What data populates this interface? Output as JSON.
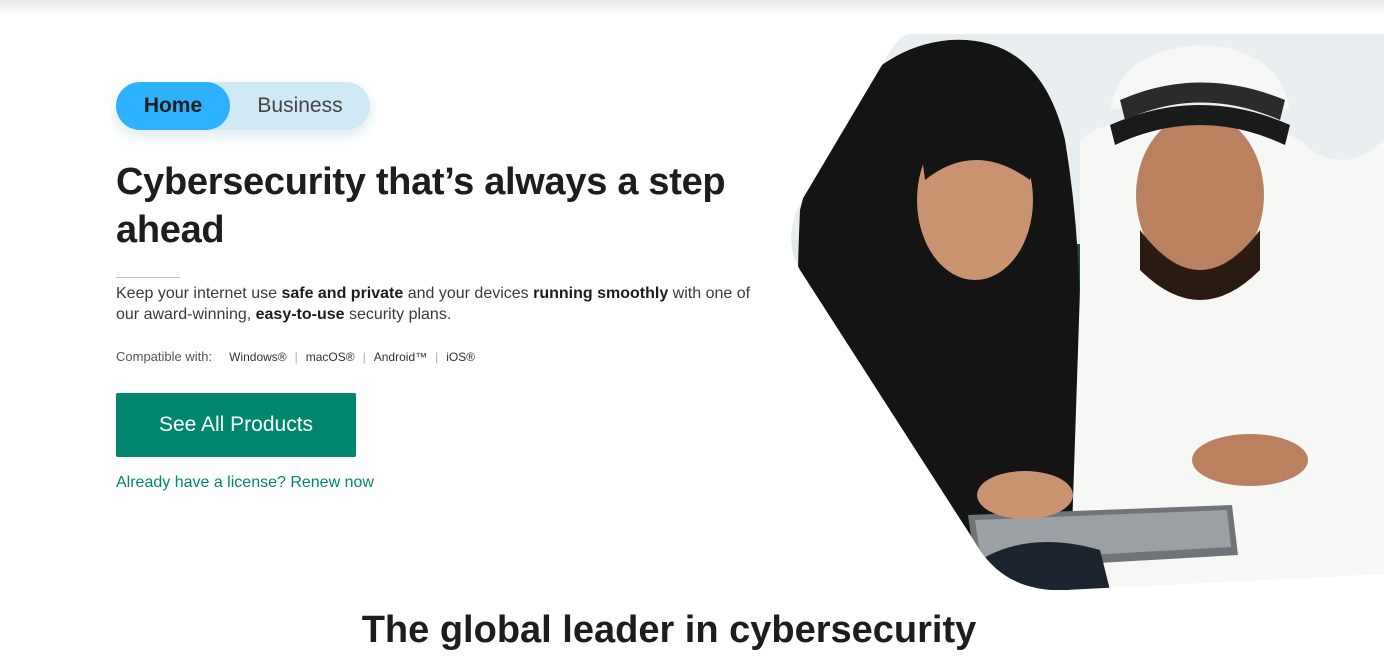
{
  "segment_toggle": {
    "active_label": "Home",
    "inactive_label": "Business"
  },
  "hero": {
    "headline": "Cybersecurity that’s always a step ahead",
    "lead": {
      "part1": "Keep your internet use ",
      "bold1": "safe and private",
      "part2": " and your devices ",
      "bold2": "running smoothly",
      "part3": " with one of our award-winning, ",
      "bold3": "easy-to-use",
      "part4": " security plans."
    },
    "compatibility": {
      "label": "Compatible with:",
      "platforms": [
        "Windows®",
        "macOS®",
        "Android™",
        "iOS®"
      ]
    },
    "cta_label": "See All Products",
    "renew_link": "Already have a license? Renew now"
  },
  "section_title": "The global leader in cybersecurity",
  "colors": {
    "accent_green": "#00866e",
    "toggle_active": "#2db2ff",
    "toggle_track": "#cfe9f7"
  }
}
